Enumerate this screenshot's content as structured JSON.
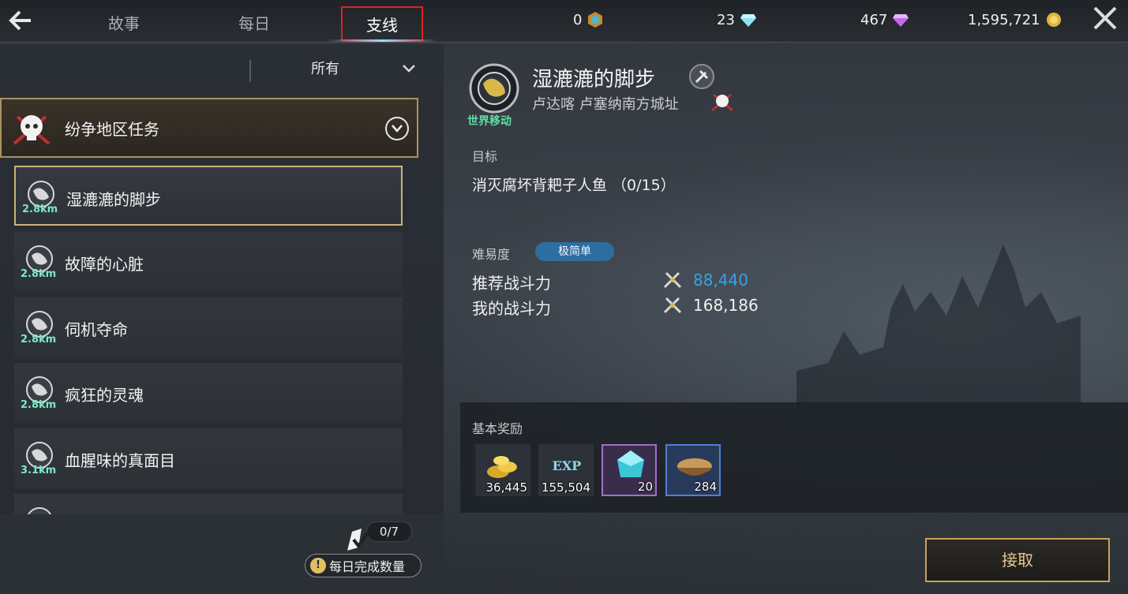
{
  "nav": {
    "back_icon": "back-arrow-icon",
    "tabs": [
      {
        "label": "故事"
      },
      {
        "label": "每日"
      },
      {
        "label": "支线"
      }
    ],
    "close_icon": "close-icon"
  },
  "currencies": [
    {
      "value": "0",
      "icon": "medal-icon"
    },
    {
      "value": "23",
      "icon": "blue-diamond-icon"
    },
    {
      "value": "467",
      "icon": "purple-diamond-icon"
    },
    {
      "value": "1,595,721",
      "icon": "gold-coin-icon"
    }
  ],
  "filter": {
    "label": "所有"
  },
  "category": {
    "label": "纷争地区任务"
  },
  "quests": [
    {
      "name": "湿漉漉的脚步",
      "distance": "2.8km"
    },
    {
      "name": "故障的心脏",
      "distance": "2.8km"
    },
    {
      "name": "伺机夺命",
      "distance": "2.8km"
    },
    {
      "name": "疯狂的灵魂",
      "distance": "2.8km"
    },
    {
      "name": "血腥味的真面目",
      "distance": "3.1km"
    }
  ],
  "daily": {
    "count": "0/7",
    "label": "每日完成数量"
  },
  "detail": {
    "badge_label": "世界移动",
    "title": "湿漉漉的脚步",
    "location": "卢达喀 卢塞纳南方城址",
    "objective_label": "目标",
    "objective": "消灭腐坏背耙子人鱼 （0/15）",
    "difficulty_label": "难易度",
    "difficulty": "极简单",
    "recommended_power_label": "推荐战斗力",
    "recommended_power": "88,440",
    "my_power_label": "我的战斗力",
    "my_power": "168,186",
    "rewards_label": "基本奖励",
    "rewards": [
      {
        "qty": "36,445",
        "icon": "gold-coins-icon"
      },
      {
        "qty": "155,504",
        "icon": "exp-icon",
        "text": "EXP"
      },
      {
        "qty": "20",
        "icon": "crystal-icon"
      },
      {
        "qty": "284",
        "icon": "food-bowl-icon"
      }
    ],
    "accept_label": "接取"
  },
  "colors": {
    "accent_gold": "#c9a45a",
    "recommended_power": "#3aa0e0",
    "distance": "#7ae8c8",
    "difficulty_badge": "#2d6ea0",
    "active_tab_highlight": "#e02020"
  }
}
